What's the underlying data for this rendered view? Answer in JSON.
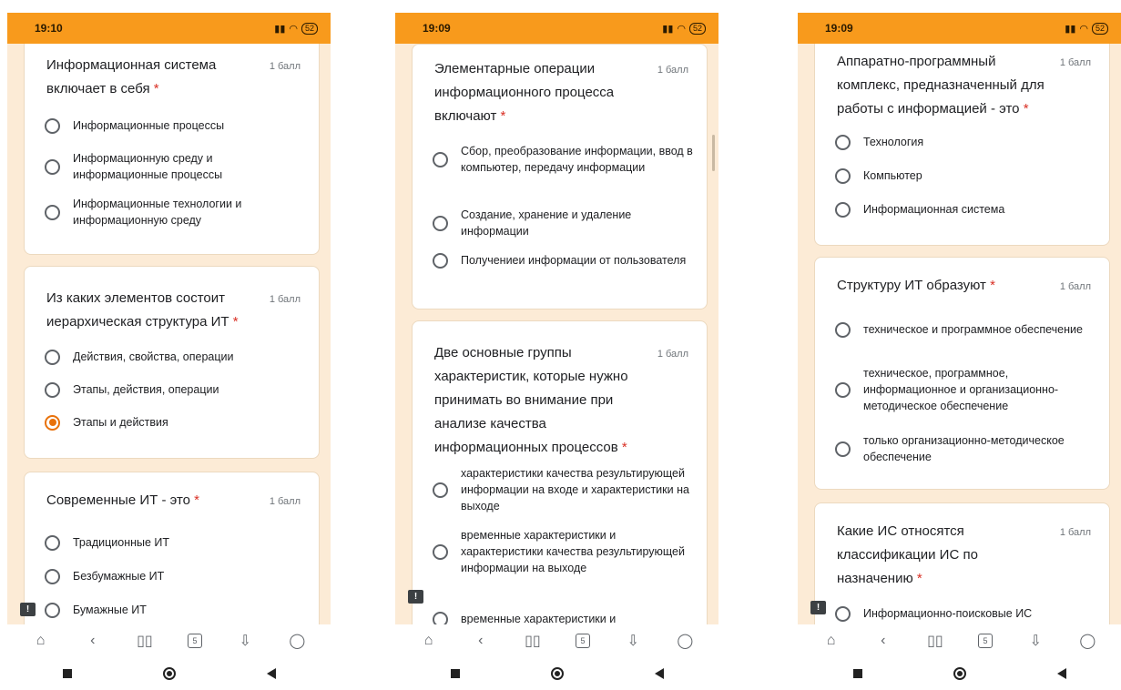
{
  "points_label": "1 балл",
  "phones": [
    {
      "time": "19:10",
      "battery": "52",
      "cards": [
        {
          "question": "Информационная система включает в себя",
          "options": [
            {
              "label": "Информационные процессы",
              "selected": false
            },
            {
              "label": "Информационную среду и информационные процессы",
              "selected": false
            },
            {
              "label": "Информационные технологии и информационную среду",
              "selected": false
            }
          ]
        },
        {
          "question": "Из каких элементов состоит иерархическая структура ИТ",
          "options": [
            {
              "label": "Действия, свойства, операции",
              "selected": false
            },
            {
              "label": "Этапы, действия, операции",
              "selected": false
            },
            {
              "label": "Этапы и действия",
              "selected": true
            }
          ]
        },
        {
          "question": "Современные ИТ - это",
          "options": [
            {
              "label": "Традиционные ИТ",
              "selected": false
            },
            {
              "label": "Безбумажные ИТ",
              "selected": false
            },
            {
              "label": "Бумажные ИТ",
              "selected": false
            }
          ]
        }
      ]
    },
    {
      "time": "19:09",
      "battery": "52",
      "cards": [
        {
          "question": "Элементарные операции информационного процесса включают",
          "options": [
            {
              "label": "Сбор, преобразование информации, ввод в компьютер, передачу информации",
              "selected": false
            },
            {
              "label": "Создание, хранение и удаление информации",
              "selected": false
            },
            {
              "label": "Получениеи информации от пользователя",
              "selected": false
            }
          ]
        },
        {
          "question": "Две основные группы характеристик, которые нужно принимать во внимание при анализе качества информационных процессов",
          "options": [
            {
              "label": "характеристики качества результирующей информации на входе и характеристики на выходе",
              "selected": false
            },
            {
              "label": "временные характеристики и характеристики качества результирующей информации на выходе",
              "selected": false
            },
            {
              "label": "временные характеристики и",
              "selected": false
            }
          ]
        }
      ]
    },
    {
      "time": "19:09",
      "battery": "52",
      "cards": [
        {
          "question": "Аппаратно-программный комплекс, предназначенный для работы с информацией - это",
          "options": [
            {
              "label": "Технология",
              "selected": false
            },
            {
              "label": "Компьютер",
              "selected": false
            },
            {
              "label": "Информационная система",
              "selected": false
            }
          ]
        },
        {
          "question": "Структуру ИТ образуют",
          "options": [
            {
              "label": "техническое и программное обеспечение",
              "selected": false
            },
            {
              "label": "техническое, программное, информационное и организационно-методическое обеспечение",
              "selected": false
            },
            {
              "label": "только организационно-методическое обеспечение",
              "selected": false
            }
          ]
        },
        {
          "question": "Какие ИС относятся классификации ИС по назначению",
          "options": [
            {
              "label": "Информационно-поисковые ИС",
              "selected": false
            }
          ]
        }
      ]
    }
  ],
  "icons": {
    "nav": [
      "home-icon",
      "back-icon",
      "book-icon",
      "tabs-icon",
      "download-icon",
      "profile-icon"
    ],
    "tabs_count": "5",
    "feedback": "!"
  },
  "colors": {
    "status": "#f89a1c",
    "background": "#fcebd6",
    "accent": "#e8710a",
    "required": "#d93025"
  }
}
